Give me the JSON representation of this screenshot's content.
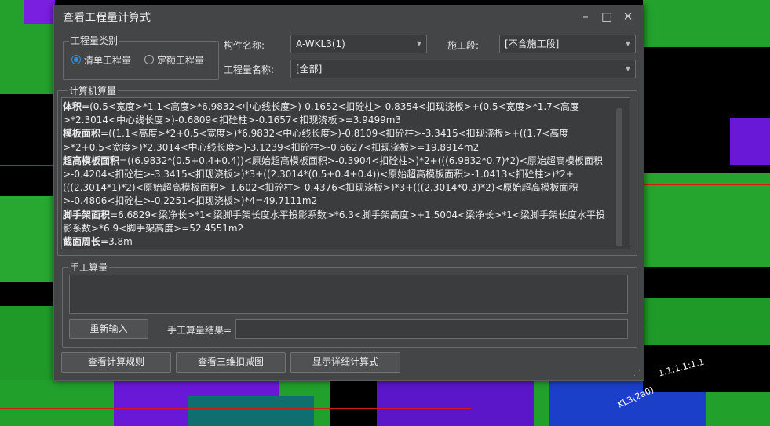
{
  "dialog": {
    "title": "查看工程量计算式",
    "category_group": {
      "label": "工程量类别",
      "options": [
        "清单工程量",
        "定额工程量"
      ],
      "selected": "清单工程量"
    },
    "component": {
      "label": "构件名称:",
      "value": "A-WKL3(1)"
    },
    "section": {
      "label": "施工段:",
      "value": "[不含施工段]"
    },
    "quantity_name": {
      "label": "工程量名称:",
      "value": "[全部]"
    },
    "computer_calc": {
      "label": "计算机算量",
      "entries": [
        {
          "name": "体积",
          "formula": "=(0.5<宽度>*1.1<高度>*6.9832<中心线长度>)-0.1652<扣砼柱>-0.8354<扣现浇板>+(0.5<宽度>*1.7<高度>*2.3014<中心线长度>)-0.6809<扣砼柱>-0.1657<扣现浇板>=3.9499m3"
        },
        {
          "name": "模板面积",
          "formula": "=((1.1<高度>*2+0.5<宽度>)*6.9832<中心线长度>)-0.8109<扣砼柱>-3.3415<扣现浇板>+((1.7<高度>*2+0.5<宽度>)*2.3014<中心线长度>)-3.1239<扣砼柱>-0.6627<扣现浇板>=19.8914m2"
        },
        {
          "name": "超高模板面积",
          "formula": "=((6.9832*(0.5+0.4+0.4))<原始超高模板面积>-0.3904<扣砼柱>)*2+(((6.9832*0.7)*2)<原始超高模板面积>-0.4204<扣砼柱>-3.3415<扣现浇板>)*3+((2.3014*(0.5+0.4+0.4))<原始超高模板面积>-1.0413<扣砼柱>)*2+(((2.3014*1)*2)<原始超高模板面积>-1.602<扣砼柱>-0.4376<扣现浇板>)*3+(((2.3014*0.3)*2)<原始超高模板面积>-0.4806<扣砼柱>-0.2251<扣现浇板>)*4=49.7111m2"
        },
        {
          "name": "脚手架面积",
          "formula": "=6.6829<梁净长>*1<梁脚手架长度水平投影系数>*6.3<脚手架高度>+1.5004<梁净长>*1<梁脚手架长度水平投影系数>*6.9<脚手架高度>=52.4551m2"
        },
        {
          "name": "截面周长",
          "formula": "=3.8m"
        }
      ]
    },
    "manual_calc": {
      "label": "手工算量",
      "reinput_button": "重新输入",
      "result_label": "手工算量结果=",
      "result_value": ""
    },
    "buttons": {
      "view_rules": "查看计算规则",
      "view_3d": "查看三维扣减图",
      "show_detail": "显示详细计算式"
    }
  },
  "background_texts": [
    "1.1:1.1:1.1",
    "KL3(2a0)"
  ],
  "colors": {
    "accent": "#2e8fe0",
    "dialog_bg": "#444546",
    "green": "#1fa52b",
    "purple": "#6a18d8"
  }
}
